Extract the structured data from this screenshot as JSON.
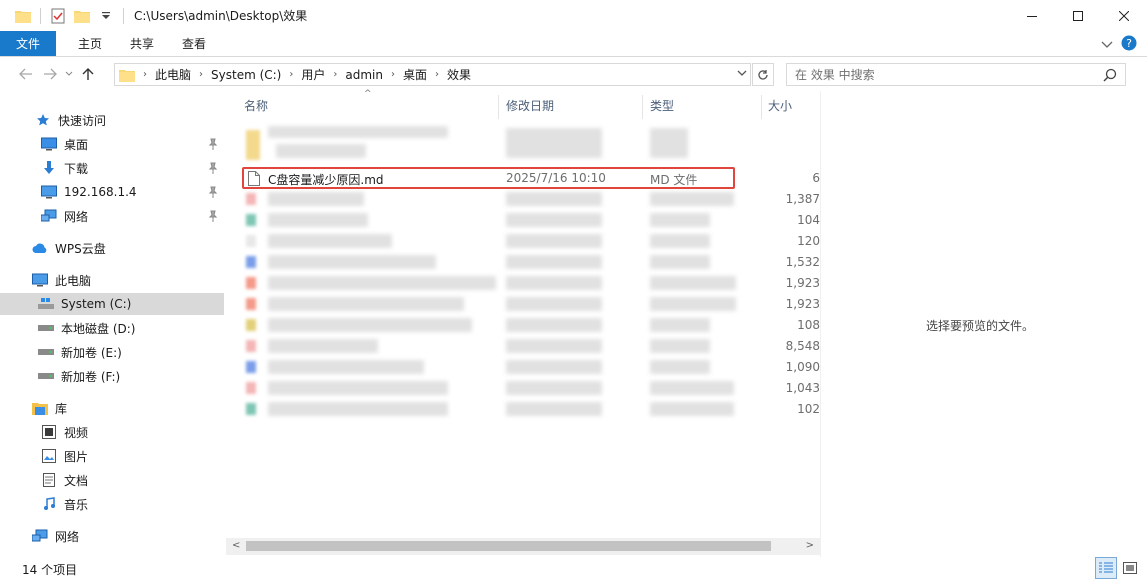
{
  "titlebar": {
    "path": "C:\\Users\\admin\\Desktop\\效果"
  },
  "ribbon": {
    "tabs": [
      "文件",
      "主页",
      "共享",
      "查看"
    ]
  },
  "address": {
    "crumbs": [
      "此电脑",
      "System (C:)",
      "用户",
      "admin",
      "桌面",
      "效果"
    ],
    "search_placeholder": "在 效果 中搜索"
  },
  "sidebar": {
    "quick_access": "快速访问",
    "quick_items": [
      "桌面",
      "下载",
      "192.168.1.4",
      "网络"
    ],
    "wps": "WPS云盘",
    "this_pc": "此电脑",
    "drives": [
      "System (C:)",
      "本地磁盘 (D:)",
      "新加卷 (E:)",
      "新加卷 (F:)"
    ],
    "library": "库",
    "lib_items": [
      "视频",
      "图片",
      "文档",
      "音乐"
    ],
    "network": "网络"
  },
  "columns": {
    "name": "名称",
    "date": "修改日期",
    "type": "类型",
    "size": "大小"
  },
  "highlighted_file": {
    "name": "C盘容量减少原因.md",
    "date": "2025/7/16 10:10",
    "type": "MD 文件",
    "size": "6"
  },
  "sizes": [
    "1,387",
    "104",
    "120",
    "1,532",
    "1,923",
    "1,923",
    "108",
    "8,548",
    "1,090",
    "1,043",
    "102"
  ],
  "preview": {
    "message": "选择要预览的文件。"
  },
  "status": {
    "count": "14 个项目"
  },
  "colors": {
    "accent": "#1979ca",
    "highlight_border": "#e0463c",
    "selected_nav": "#d9d9d9"
  }
}
